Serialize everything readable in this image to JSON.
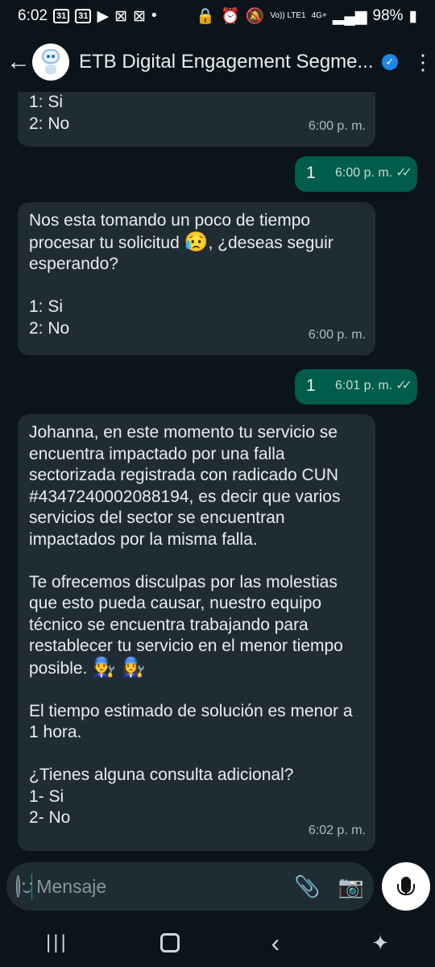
{
  "status_bar": {
    "time": "6:02",
    "calendar_badge_1": "31",
    "calendar_badge_2": "31",
    "network_label": "Vo)) LTE1",
    "signal_label": "4G+",
    "battery": "98%"
  },
  "header": {
    "title": "ETB Digital Engagement Segme..."
  },
  "messages": [
    {
      "direction": "in",
      "text": "1: Si\n2: No",
      "time": "6:00 p. m."
    },
    {
      "direction": "out",
      "text": "1",
      "time": "6:00 p. m."
    },
    {
      "direction": "in",
      "text_before": "Nos esta tomando un poco de tiempo procesar tu solicitud ",
      "emoji": "😥",
      "text_after": ", ¿deseas seguir esperando?\n\n1: Si\n2: No",
      "time": "6:00 p. m."
    },
    {
      "direction": "out",
      "text": "1",
      "time": "6:01 p. m."
    },
    {
      "direction": "in",
      "text_before": "Johanna, en este momento tu servicio se encuentra impactado por una falla sectorizada registrada con radicado CUN #4347240002088194, es decir que varios servicios del sector se encuentran impactados por la misma falla.\n\nTe ofrecemos disculpas por las molestias que esto pueda causar, nuestro equipo técnico se encuentra trabajando para restablecer tu servicio en el menor tiempo posible. ",
      "emoji": "👨‍🔧 👩‍🔧",
      "text_after": "\n\nEl tiempo estimado de solución es menor a 1 hora.\n\n¿Tienes alguna consulta adicional?\n1- Si\n2- No",
      "time": "6:02 p. m."
    }
  ],
  "composer": {
    "placeholder": "Mensaje"
  },
  "icons": {
    "back": "back-arrow-icon",
    "verified": "verified-badge-icon",
    "menu": "more-vert-icon",
    "emoji": "emoji-icon",
    "attach": "paperclip-icon",
    "camera": "camera-icon",
    "mic": "microphone-icon"
  },
  "colors": {
    "background": "#0b141a",
    "incoming_bubble": "#202c33",
    "outgoing_bubble": "#005c4b",
    "accent": "#00a884",
    "verified": "#1e88e5"
  }
}
